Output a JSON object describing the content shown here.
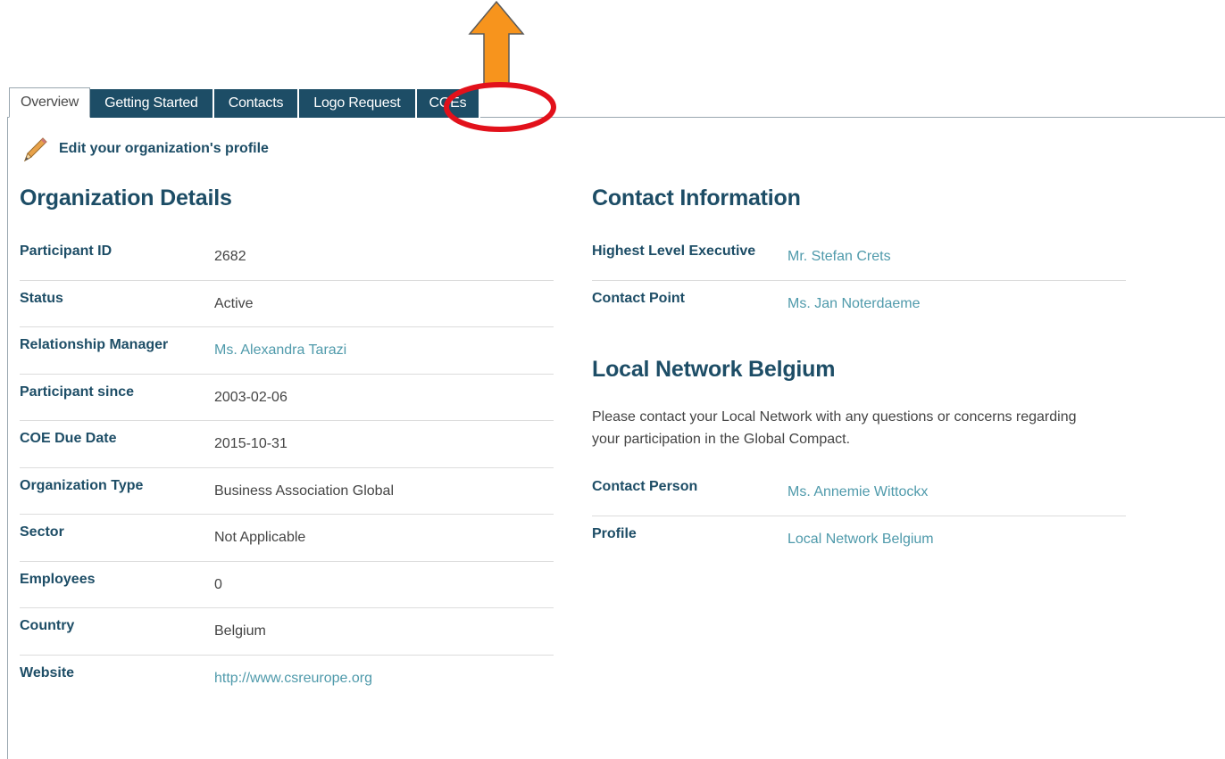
{
  "tabs": [
    {
      "label": "Overview",
      "active": true
    },
    {
      "label": "Getting Started"
    },
    {
      "label": "Contacts"
    },
    {
      "label": "Logo Request"
    },
    {
      "label": "COEs"
    }
  ],
  "edit_link": {
    "label": "Edit your organization's profile",
    "icon": "pencil-icon"
  },
  "organization_details": {
    "title": "Organization Details",
    "rows": [
      {
        "label": "Participant ID",
        "value": "2682"
      },
      {
        "label": "Status",
        "value": "Active"
      },
      {
        "label": "Relationship Manager",
        "value": "Ms. Alexandra Tarazi"
      },
      {
        "label": "Participant since",
        "value": "2003-02-06"
      },
      {
        "label": "COE Due Date",
        "value": "2015-10-31"
      },
      {
        "label": "Organization Type",
        "value": "Business Association Global"
      },
      {
        "label": "Sector",
        "value": "Not Applicable"
      },
      {
        "label": "Employees",
        "value": "0"
      },
      {
        "label": "Country",
        "value": "Belgium"
      },
      {
        "label": "Website",
        "value": "http://www.csreurope.org"
      }
    ]
  },
  "contact_information": {
    "title": "Contact Information",
    "rows": [
      {
        "label": "Highest Level Executive",
        "value": "Mr. Stefan Crets"
      },
      {
        "label": "Contact Point",
        "value": "Ms. Jan Noterdaeme"
      }
    ]
  },
  "local_network": {
    "title": "Local Network Belgium",
    "note": "Please contact your Local Network with any questions or concerns regarding your participation in the Global Compact.",
    "rows": [
      {
        "label": "Contact Person",
        "value": "Ms. Annemie Wittockx"
      },
      {
        "label": "Profile",
        "value": "Local Network Belgium"
      }
    ]
  },
  "colors": {
    "tab_bg": "#1d4d66",
    "heading": "#1d4d66",
    "link": "#4f9aab",
    "annotation_arrow": "#f7941d",
    "annotation_circle": "#e2111b"
  }
}
